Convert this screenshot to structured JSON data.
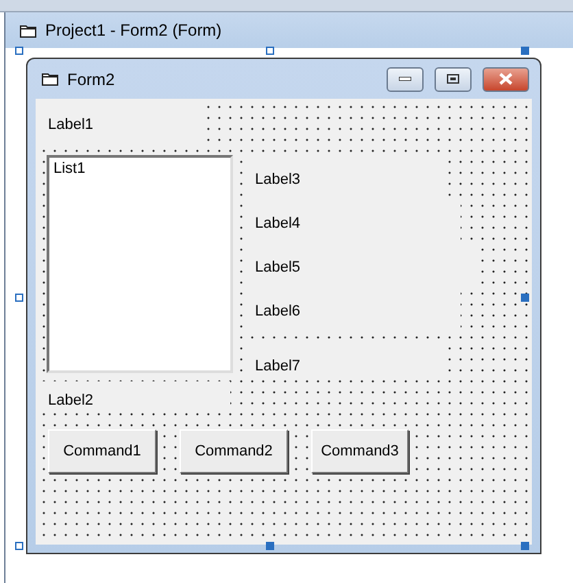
{
  "designer_window": {
    "title": "Project1 - Form2 (Form)"
  },
  "form": {
    "title": "Form2",
    "controls": [
      {
        "kind": "label",
        "caption": "Label1"
      },
      {
        "kind": "listbox",
        "caption": "List1"
      },
      {
        "kind": "label",
        "caption": "Label3"
      },
      {
        "kind": "label",
        "caption": "Label4"
      },
      {
        "kind": "label",
        "caption": "Label5"
      },
      {
        "kind": "label",
        "caption": "Label6"
      },
      {
        "kind": "label",
        "caption": "Label7"
      },
      {
        "kind": "label",
        "caption": "Label2"
      },
      {
        "kind": "button",
        "caption": "Command1"
      },
      {
        "kind": "button",
        "caption": "Command2"
      },
      {
        "kind": "button",
        "caption": "Command3"
      }
    ]
  }
}
